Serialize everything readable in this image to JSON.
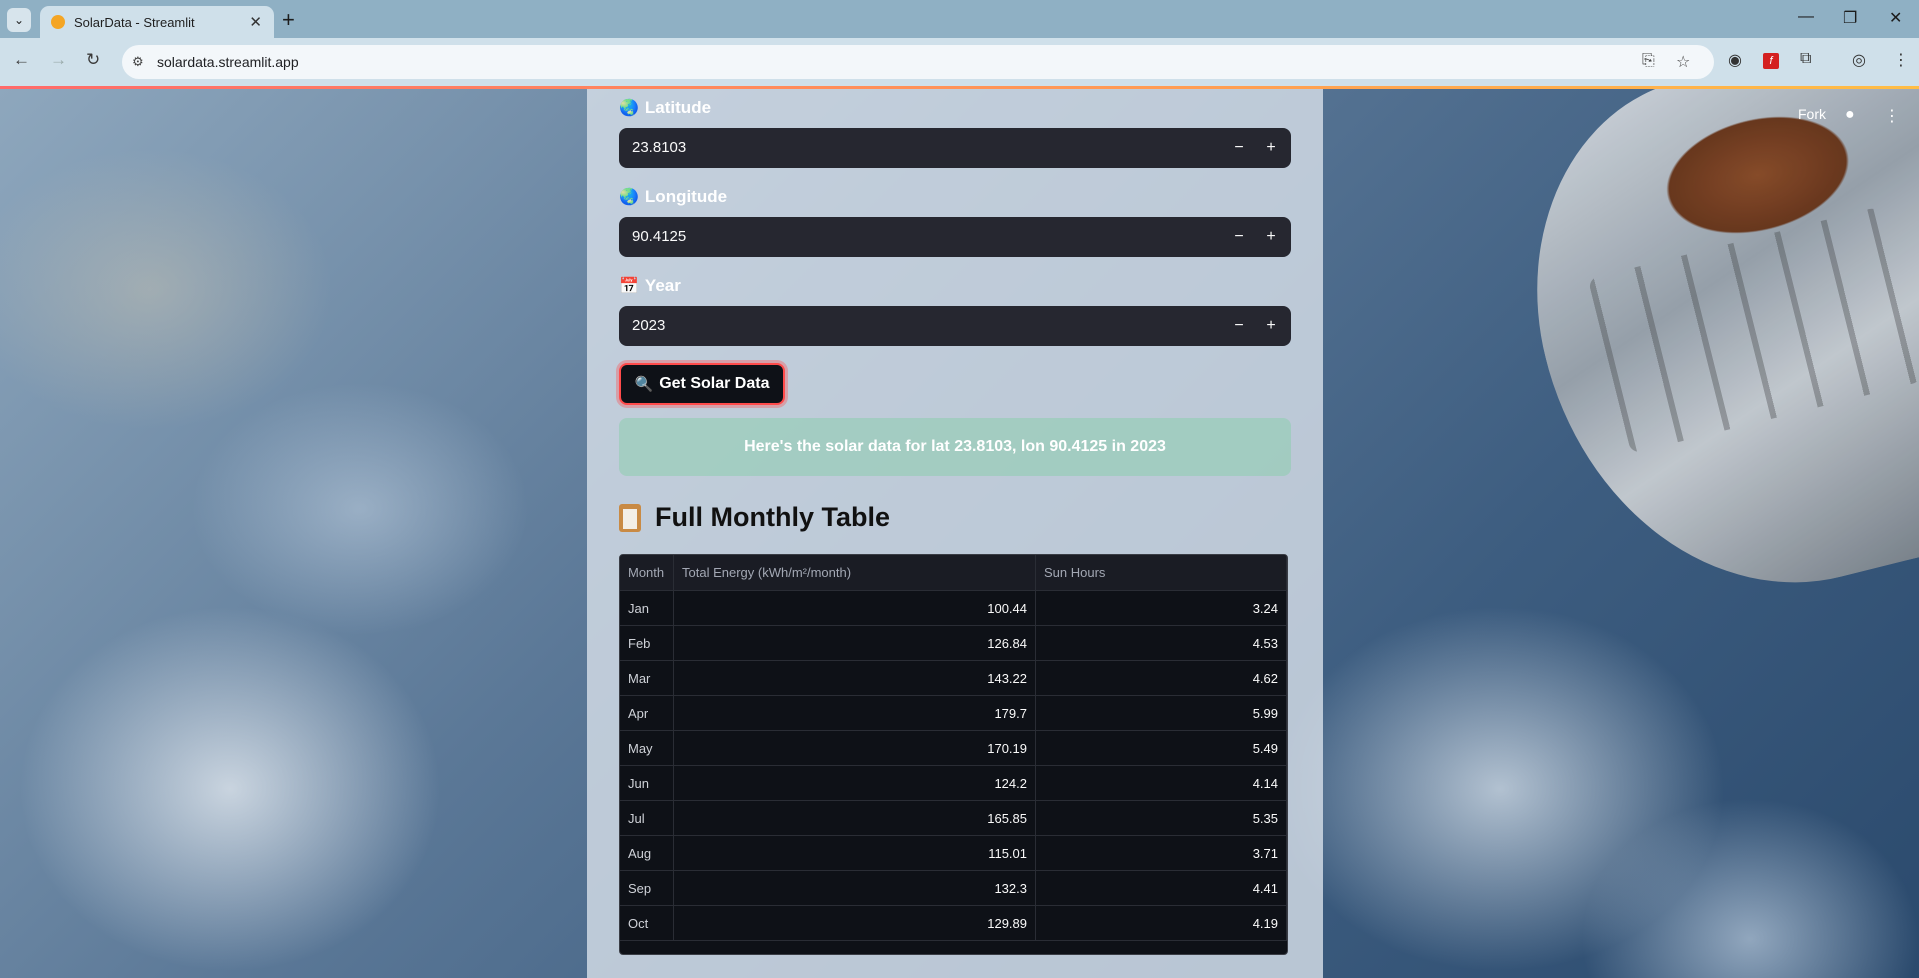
{
  "browser": {
    "tab_title": "SolarData - Streamlit",
    "url": "solardata.streamlit.app"
  },
  "app_header": {
    "fork_label": "Fork",
    "github_icon": "github-icon",
    "menu_icon": "kebab-menu-icon"
  },
  "form": {
    "latitude": {
      "label": "Latitude",
      "value": "23.8103",
      "icon": "globe-icon"
    },
    "longitude": {
      "label": "Longitude",
      "value": "90.4125",
      "icon": "globe-icon"
    },
    "year": {
      "label": "Year",
      "value": "2023",
      "icon": "calendar-icon"
    },
    "minus_label": "−",
    "plus_label": "+",
    "submit_label": "Get Solar Data",
    "submit_icon": "magnifier-icon"
  },
  "result": {
    "message": "Here's the solar data for lat 23.8103, lon 90.4125 in 2023"
  },
  "table_section": {
    "title": "Full Monthly Table",
    "icon": "clipboard-icon",
    "columns": [
      "Month",
      "Total Energy (kWh/m²/month)",
      "Sun Hours"
    ],
    "rows": [
      [
        "Jan",
        "100.44",
        "3.24"
      ],
      [
        "Feb",
        "126.84",
        "4.53"
      ],
      [
        "Mar",
        "143.22",
        "4.62"
      ],
      [
        "Apr",
        "179.7",
        "5.99"
      ],
      [
        "May",
        "170.19",
        "5.49"
      ],
      [
        "Jun",
        "124.2",
        "4.14"
      ],
      [
        "Jul",
        "165.85",
        "5.35"
      ],
      [
        "Aug",
        "115.01",
        "3.71"
      ],
      [
        "Sep",
        "132.3",
        "4.41"
      ],
      [
        "Oct",
        "129.89",
        "4.19"
      ]
    ]
  },
  "colors": {
    "accent": "#ff4b4b",
    "input_bg": "#262730",
    "table_bg": "#0e1117",
    "success_bg": "#8ccdaf"
  }
}
